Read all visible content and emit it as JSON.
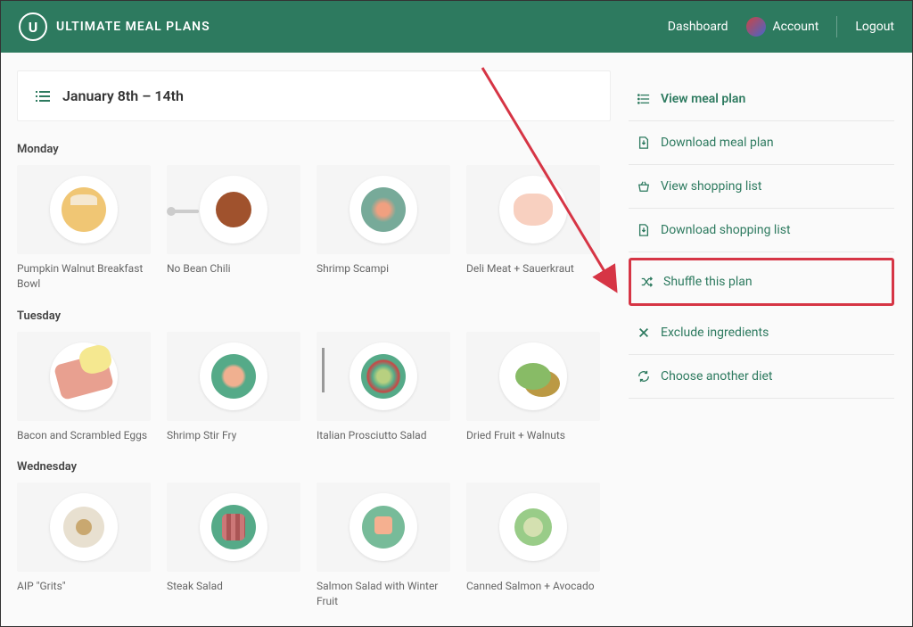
{
  "brand": "ULTIMATE MEAL PLANS",
  "nav": {
    "dashboard": "Dashboard",
    "account": "Account",
    "logout": "Logout"
  },
  "dateRange": "January 8th – 14th",
  "days": [
    {
      "name": "Monday",
      "meals": [
        {
          "name": "Pumpkin Walnut Breakfast Bowl"
        },
        {
          "name": "No Bean Chili"
        },
        {
          "name": "Shrimp Scampi"
        },
        {
          "name": "Deli Meat + Sauerkraut"
        }
      ]
    },
    {
      "name": "Tuesday",
      "meals": [
        {
          "name": "Bacon and Scrambled Eggs"
        },
        {
          "name": "Shrimp Stir Fry"
        },
        {
          "name": "Italian Prosciutto Salad"
        },
        {
          "name": "Dried Fruit + Walnuts"
        }
      ]
    },
    {
      "name": "Wednesday",
      "meals": [
        {
          "name": "AIP \"Grits\""
        },
        {
          "name": "Steak Salad"
        },
        {
          "name": "Salmon Salad with Winter Fruit"
        },
        {
          "name": "Canned Salmon + Avocado"
        }
      ]
    }
  ],
  "sidebar": {
    "viewPlan": "View meal plan",
    "downloadPlan": "Download meal plan",
    "viewList": "View shopping list",
    "downloadList": "Download shopping list",
    "shuffle": "Shuffle this plan",
    "exclude": "Exclude ingredients",
    "choose": "Choose another diet"
  }
}
